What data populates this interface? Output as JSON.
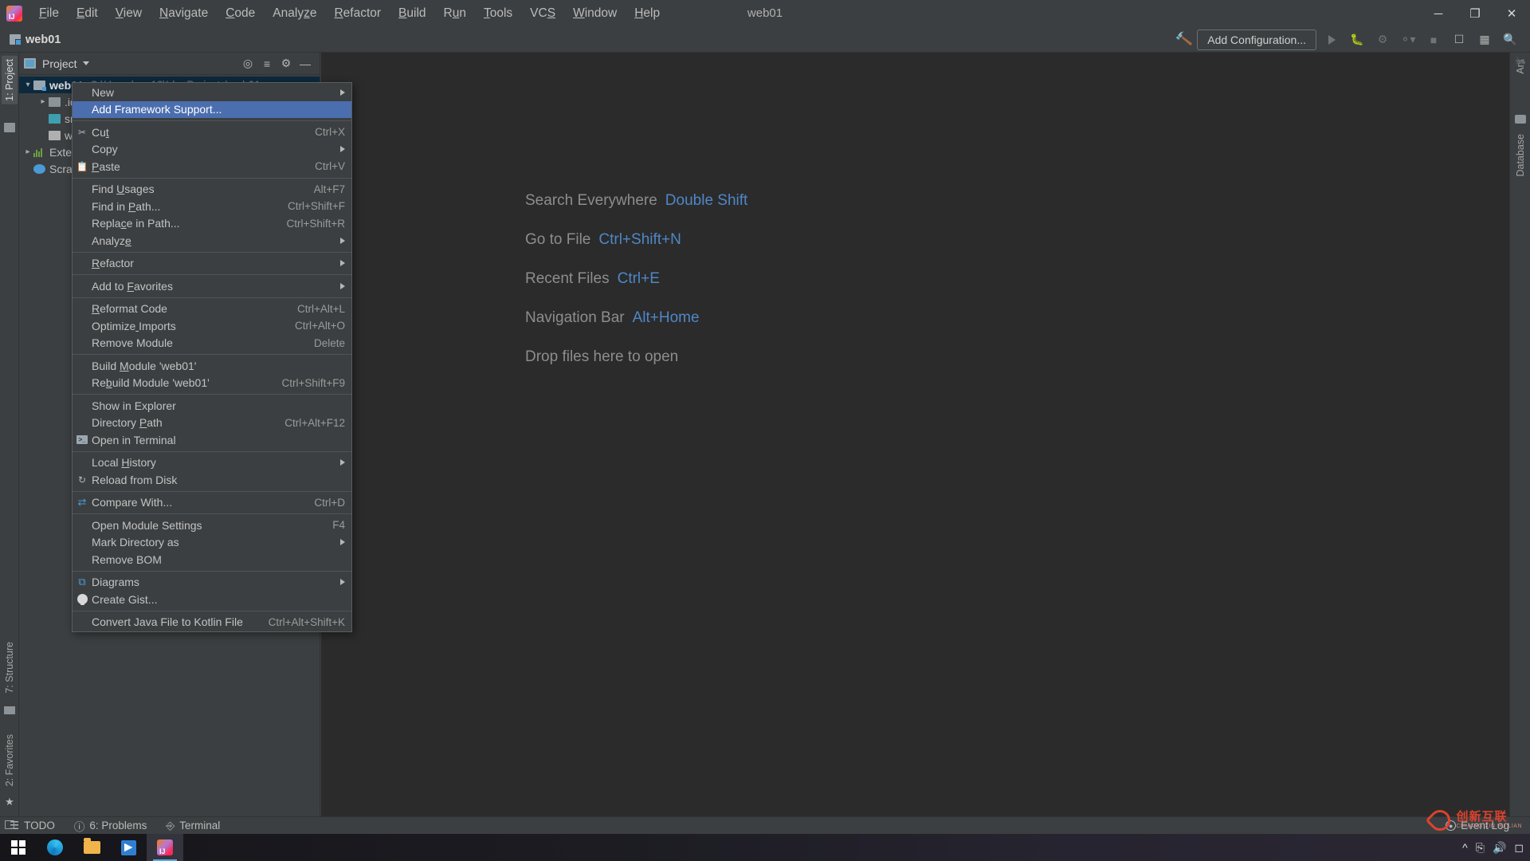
{
  "window": {
    "title": "web01",
    "minimize": "─",
    "maximize": "❐",
    "close": "✕"
  },
  "menubar": [
    {
      "label": "File",
      "mnemonic": "F"
    },
    {
      "label": "Edit",
      "mnemonic": "E"
    },
    {
      "label": "View",
      "mnemonic": "V"
    },
    {
      "label": "Navigate",
      "mnemonic": "N"
    },
    {
      "label": "Code",
      "mnemonic": "C"
    },
    {
      "label": "Analyze",
      "mnemonic": "z"
    },
    {
      "label": "Refactor",
      "mnemonic": "R"
    },
    {
      "label": "Build",
      "mnemonic": "B"
    },
    {
      "label": "Run",
      "mnemonic": "u"
    },
    {
      "label": "Tools",
      "mnemonic": "T"
    },
    {
      "label": "VCS",
      "mnemonic": "S"
    },
    {
      "label": "Window",
      "mnemonic": "W"
    },
    {
      "label": "Help",
      "mnemonic": "H"
    }
  ],
  "navbar": {
    "module": "web01",
    "add_configuration": "Add Configuration...",
    "icons": [
      "hammer-icon",
      "run-icon",
      "debug-icon",
      "coverage-icon",
      "profile-icon",
      "stop-icon",
      "update-icon",
      "layout-icon",
      "search-icon"
    ]
  },
  "left_strip": {
    "tabs": [
      "1: Project"
    ],
    "bottom_tabs": [
      "7: Structure",
      "2: Favorites"
    ]
  },
  "right_strip": {
    "tabs": [
      "Ant",
      "Database"
    ]
  },
  "project_panel": {
    "title": "Project",
    "toolbar_icons": [
      "locate-icon",
      "collapse-all-icon",
      "gear-icon",
      "hide-icon"
    ],
    "tree": [
      {
        "depth": 0,
        "arrow": "down",
        "icon": "module",
        "label": "web01",
        "bold": true,
        "path": "C:\\Users\\vsv18\\IdeaProjects\\web01",
        "selected": true
      },
      {
        "depth": 1,
        "arrow": "right",
        "icon": "grey",
        "label": ".idea",
        "bold": false,
        "path": ""
      },
      {
        "depth": 1,
        "arrow": "",
        "icon": "teal",
        "label": "src",
        "bold": false,
        "path": ""
      },
      {
        "depth": 1,
        "arrow": "",
        "icon": "xml",
        "label": "web01.iml",
        "bold": false,
        "path": ""
      },
      {
        "depth": 0,
        "arrow": "right",
        "icon": "bars",
        "label": "External Libraries",
        "bold": false,
        "path": ""
      },
      {
        "depth": 0,
        "arrow": "",
        "icon": "scratch",
        "label": "Scratches and Consoles",
        "bold": false,
        "path": ""
      }
    ]
  },
  "editor": {
    "tips": [
      {
        "label": "Search Everywhere",
        "shortcut": "Double Shift"
      },
      {
        "label": "Go to File",
        "shortcut": "Ctrl+Shift+N"
      },
      {
        "label": "Recent Files",
        "shortcut": "Ctrl+E"
      },
      {
        "label": "Navigation Bar",
        "shortcut": "Alt+Home"
      },
      {
        "label": "Drop files here to open",
        "shortcut": ""
      }
    ]
  },
  "context_menu": {
    "items": [
      {
        "type": "item",
        "label": "New",
        "shortcut": "",
        "submenu": true,
        "icon": "",
        "mnemonic": ""
      },
      {
        "type": "item",
        "label": "Add Framework Support...",
        "shortcut": "",
        "submenu": false,
        "icon": "",
        "highlighted": true
      },
      {
        "type": "sep"
      },
      {
        "type": "item",
        "label": "Cut",
        "shortcut": "Ctrl+X",
        "submenu": false,
        "icon": "scissors-icon"
      },
      {
        "type": "item",
        "label": "Copy",
        "shortcut": "",
        "submenu": true,
        "icon": ""
      },
      {
        "type": "item",
        "label": "Paste",
        "shortcut": "Ctrl+V",
        "submenu": false,
        "icon": "clipboard-icon"
      },
      {
        "type": "sep"
      },
      {
        "type": "item",
        "label": "Find Usages",
        "shortcut": "Alt+F7",
        "submenu": false,
        "icon": ""
      },
      {
        "type": "item",
        "label": "Find in Path...",
        "shortcut": "Ctrl+Shift+F",
        "submenu": false,
        "icon": ""
      },
      {
        "type": "item",
        "label": "Replace in Path...",
        "shortcut": "Ctrl+Shift+R",
        "submenu": false,
        "icon": ""
      },
      {
        "type": "item",
        "label": "Analyze",
        "shortcut": "",
        "submenu": true,
        "icon": ""
      },
      {
        "type": "sep"
      },
      {
        "type": "item",
        "label": "Refactor",
        "shortcut": "",
        "submenu": true,
        "icon": ""
      },
      {
        "type": "sep"
      },
      {
        "type": "item",
        "label": "Add to Favorites",
        "shortcut": "",
        "submenu": true,
        "icon": ""
      },
      {
        "type": "sep"
      },
      {
        "type": "item",
        "label": "Reformat Code",
        "shortcut": "Ctrl+Alt+L",
        "submenu": false,
        "icon": ""
      },
      {
        "type": "item",
        "label": "Optimize Imports",
        "shortcut": "Ctrl+Alt+O",
        "submenu": false,
        "icon": ""
      },
      {
        "type": "item",
        "label": "Remove Module",
        "shortcut": "Delete",
        "submenu": false,
        "icon": ""
      },
      {
        "type": "sep"
      },
      {
        "type": "item",
        "label": "Build Module 'web01'",
        "shortcut": "",
        "submenu": false,
        "icon": ""
      },
      {
        "type": "item",
        "label": "Rebuild Module 'web01'",
        "shortcut": "Ctrl+Shift+F9",
        "submenu": false,
        "icon": ""
      },
      {
        "type": "sep"
      },
      {
        "type": "item",
        "label": "Show in Explorer",
        "shortcut": "",
        "submenu": false,
        "icon": ""
      },
      {
        "type": "item",
        "label": "Directory Path",
        "shortcut": "Ctrl+Alt+F12",
        "submenu": false,
        "icon": ""
      },
      {
        "type": "item",
        "label": "Open in Terminal",
        "shortcut": "",
        "submenu": false,
        "icon": "terminal-icon"
      },
      {
        "type": "sep"
      },
      {
        "type": "item",
        "label": "Local History",
        "shortcut": "",
        "submenu": true,
        "icon": ""
      },
      {
        "type": "item",
        "label": "Reload from Disk",
        "shortcut": "",
        "submenu": false,
        "icon": "refresh-icon"
      },
      {
        "type": "sep"
      },
      {
        "type": "item",
        "label": "Compare With...",
        "shortcut": "Ctrl+D",
        "submenu": false,
        "icon": "compare-icon"
      },
      {
        "type": "sep"
      },
      {
        "type": "item",
        "label": "Open Module Settings",
        "shortcut": "F4",
        "submenu": false,
        "icon": ""
      },
      {
        "type": "item",
        "label": "Mark Directory as",
        "shortcut": "",
        "submenu": true,
        "icon": ""
      },
      {
        "type": "item",
        "label": "Remove BOM",
        "shortcut": "",
        "submenu": false,
        "icon": ""
      },
      {
        "type": "sep"
      },
      {
        "type": "item",
        "label": "Diagrams",
        "shortcut": "",
        "submenu": true,
        "icon": "diagram-icon"
      },
      {
        "type": "item",
        "label": "Create Gist...",
        "shortcut": "",
        "submenu": false,
        "icon": "github-icon"
      },
      {
        "type": "sep"
      },
      {
        "type": "item",
        "label": "Convert Java File to Kotlin File",
        "shortcut": "Ctrl+Alt+Shift+K",
        "submenu": false,
        "icon": ""
      }
    ]
  },
  "statusbar": {
    "items": [
      {
        "label": "TODO",
        "icon": "todo-icon"
      },
      {
        "label": "6: Problems",
        "icon": "problems-icon"
      },
      {
        "label": "Terminal",
        "icon": "terminal-icon"
      }
    ],
    "event_log": "Event Log"
  },
  "taskbar": {
    "apps": [
      "start-icon",
      "edge-icon",
      "explorer-icon",
      "store-icon",
      "intellij-icon"
    ],
    "tray": [
      "⌃",
      "⌨",
      "ὐA",
      "□"
    ]
  },
  "watermark": {
    "main": "创新互联",
    "sub": "CHUANG XIN HU LIAN"
  },
  "colors": {
    "accent": "#4b6eaf",
    "panel": "#3c3f41",
    "editor": "#2b2b2b",
    "link": "#4f87c7",
    "selection": "#0d293e"
  }
}
